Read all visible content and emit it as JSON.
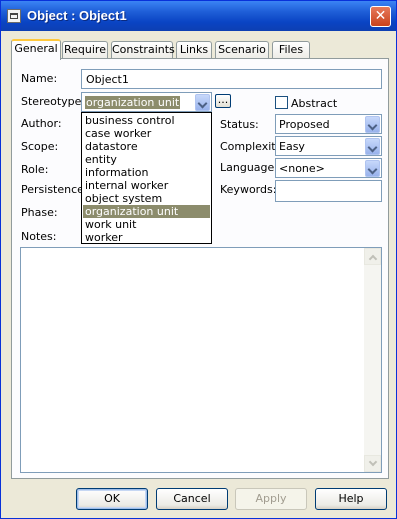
{
  "window": {
    "title": "Object : Object1",
    "title_icon": "object-icon",
    "close_glyph": "✕"
  },
  "tabs": [
    {
      "label": "General",
      "active": true
    },
    {
      "label": "Require",
      "active": false
    },
    {
      "label": "Constraints",
      "active": false
    },
    {
      "label": "Links",
      "active": false
    },
    {
      "label": "Scenario",
      "active": false
    },
    {
      "label": "Files",
      "active": false
    }
  ],
  "form": {
    "name_label": "Name:",
    "name_value": "Object1",
    "stereotype_label": "Stereotype:",
    "stereotype_value": "organization unit",
    "stereotype_button": "...",
    "author_label": "Author:",
    "scope_label": "Scope:",
    "role_label": "Role:",
    "persistence_label": "Persistence:",
    "phase_label": "Phase:",
    "notes_label": "Notes:",
    "abstract_label": "Abstract",
    "abstract_checked": false,
    "status_label": "Status:",
    "status_value": "Proposed",
    "complexity_label": "Complexity:",
    "complexity_value": "Easy",
    "language_label": "Language:",
    "language_value": "<none>",
    "keywords_label": "Keywords:",
    "keywords_value": ""
  },
  "stereotype_dropdown": {
    "items": [
      "business control",
      "case worker",
      "datastore",
      "entity",
      "information",
      "internal worker",
      "object system",
      "organization unit",
      "work unit",
      "worker"
    ],
    "selected": "organization unit"
  },
  "buttons": {
    "ok": "OK",
    "cancel": "Cancel",
    "apply": "Apply",
    "help": "Help"
  }
}
